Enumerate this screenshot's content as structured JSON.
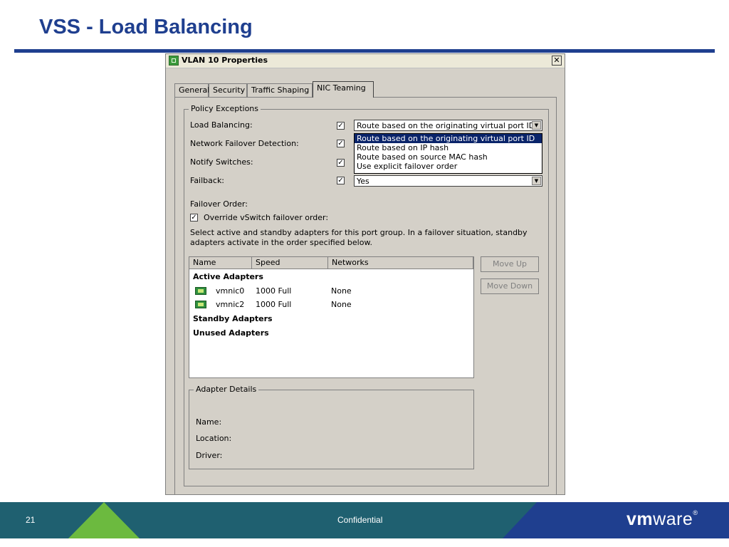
{
  "slide": {
    "title": "VSS - Load Balancing",
    "page_number": "21",
    "footer_text": "Confidential",
    "logo_bold": "vm",
    "logo_light": "ware",
    "logo_mark": "®"
  },
  "dialog": {
    "title": "VLAN 10 Properties",
    "close_glyph": "✕",
    "tabs": [
      "General",
      "Security",
      "Traffic Shaping",
      "NIC Teaming"
    ],
    "active_tab": "NIC Teaming",
    "policy_exceptions": {
      "legend": "Policy Exceptions",
      "rows": [
        {
          "label": "Load Balancing:",
          "checked": true,
          "value": "Route based on the originating virtual port ID"
        },
        {
          "label": "Network Failover Detection:",
          "checked": true,
          "value": ""
        },
        {
          "label": "Notify Switches:",
          "checked": true,
          "value": ""
        },
        {
          "label": "Failback:",
          "checked": true,
          "value": "Yes"
        }
      ],
      "dropdown_options": [
        "Route based on the originating virtual port ID",
        "Route based on IP hash",
        "Route based on source MAC hash",
        "Use explicit failover order"
      ],
      "dropdown_selected_index": 0
    },
    "failover": {
      "heading": "Failover Order:",
      "override_label": "Override vSwitch failover order:",
      "override_checked": true,
      "description_line1": "Select active and standby adapters for this port group.  In a failover situation, standby",
      "description_line2": "adapters activate  in the order specified below."
    },
    "adapters": {
      "columns": [
        "Name",
        "Speed",
        "Networks"
      ],
      "active_label": "Active Adapters",
      "active": [
        {
          "name": "vmnic0",
          "speed": "1000 Full",
          "networks": "None"
        },
        {
          "name": "vmnic2",
          "speed": "1000 Full",
          "networks": "None"
        }
      ],
      "standby_label": "Standby Adapters",
      "unused_label": "Unused Adapters"
    },
    "buttons": {
      "move_up": "Move Up",
      "move_down": "Move Down"
    },
    "adapter_details": {
      "legend": "Adapter Details",
      "name_label": "Name:",
      "location_label": "Location:",
      "driver_label": "Driver:"
    }
  },
  "colors": {
    "title_blue": "#1f3f8f",
    "footer_teal": "#1f6070",
    "footer_green": "#6cba3f",
    "selection_blue": "#0a246a",
    "dialog_gray": "#d4d0c8"
  },
  "icons": {
    "dialog_icon": "network-port-icon",
    "adapter_icon": "nic-icon",
    "checkbox_glyph": "✓",
    "combo_arrow_glyph": "▼"
  }
}
